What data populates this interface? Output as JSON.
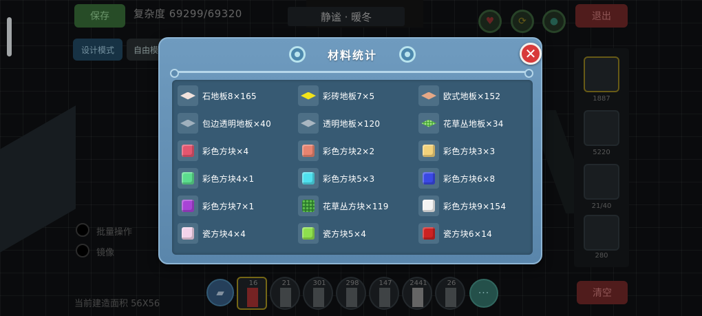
{
  "hud": {
    "save_label": "保存",
    "complexity_label": "复杂度",
    "complexity_value": "69299/69320",
    "music_title": "静谧 · 暖冬",
    "design_mode_label": "设计模式",
    "free_label": "自由模",
    "exit_label": "退出",
    "clear_label": "清空",
    "batch_label": "批量操作",
    "mirror_label": "镜像",
    "build_area_label": "当前建造面积",
    "build_area_value": "56X56",
    "right_panel_counts": [
      "1887",
      "5220",
      "21/40",
      "280"
    ],
    "toolbar_counts": [
      "16",
      "21",
      "301",
      "298",
      "147",
      "2441",
      "26"
    ],
    "more_label": "···"
  },
  "dialog": {
    "title": "材料统计",
    "close_label": "✕",
    "materials": [
      {
        "name": "石地板8×165",
        "icon": "tile",
        "color": "#f1e2dc"
      },
      {
        "name": "彩砖地板7×5",
        "icon": "tile",
        "color": "#f2e31a"
      },
      {
        "name": "欧式地板×152",
        "icon": "tile",
        "color": "#e6a886"
      },
      {
        "name": "包边透明地板×40",
        "icon": "tile",
        "color": "#9fb0bd"
      },
      {
        "name": "透明地板×120",
        "icon": "tile",
        "color": "#a9b6c1"
      },
      {
        "name": "花草丛地板×34",
        "icon": "bush-tile",
        "color": "#4aa83a"
      },
      {
        "name": "彩色方块×4",
        "icon": "cube",
        "color": "#e3566f"
      },
      {
        "name": "彩色方块2×2",
        "icon": "cube",
        "color": "#e88470"
      },
      {
        "name": "彩色方块3×3",
        "icon": "cube",
        "color": "#f3d27a"
      },
      {
        "name": "彩色方块4×1",
        "icon": "cube",
        "color": "#5cdc8e"
      },
      {
        "name": "彩色方块5×3",
        "icon": "cube",
        "color": "#4fe0ee"
      },
      {
        "name": "彩色方块6×8",
        "icon": "cube",
        "color": "#3a49e4"
      },
      {
        "name": "彩色方块7×1",
        "icon": "cube",
        "color": "#a844d6"
      },
      {
        "name": "花草丛方块×119",
        "icon": "bush",
        "color": "#2d7a2d"
      },
      {
        "name": "彩色方块9×154",
        "icon": "cube",
        "color": "#f4f4f4"
      },
      {
        "name": "瓷方块4×4",
        "icon": "cube",
        "color": "#f3d3ea"
      },
      {
        "name": "瓷方块5×4",
        "icon": "cube",
        "color": "#8ee04e"
      },
      {
        "name": "瓷方块6×14",
        "icon": "cube",
        "color": "#cc2222"
      }
    ]
  }
}
